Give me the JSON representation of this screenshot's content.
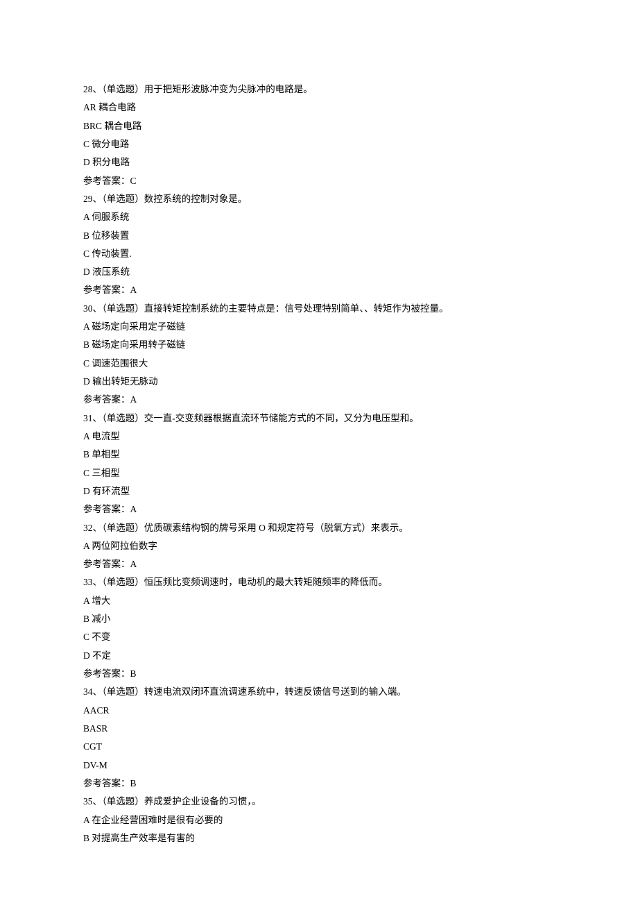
{
  "lines": [
    "28、（单选题）用于把矩形波脉冲变为尖脉冲的电路是。",
    "AR 耦合电路",
    "BRC 耦合电路",
    "C 微分电路",
    "D 积分电路",
    "参考答案：C",
    "29、（单选题）数控系统的控制对象是。",
    "A 伺服系统",
    "B 位移装置",
    "C 传动装置.",
    "D 液压系统",
    "参考答案：A",
    "30、（单选题）直接转矩控制系统的主要特点是：信号处理特别简单、、转矩作为被控量。",
    "A 磁场定向采用定子磁链",
    "B 磁场定向采用转子磁链",
    "C 调速范围很大",
    "D 输出转矩无脉动",
    "参考答案：A",
    "31、（单选题）交一直-交变频器根据直流环节储能方式的不同，又分为电压型和。",
    "A 电流型",
    "B 单相型",
    "C 三相型",
    "D 有环流型",
    "参考答案：A",
    "32、（单选题）优质碳素结构钢的牌号采用 O 和规定符号（脱氧方式）来表示。",
    "A 两位阿拉伯数字",
    "参考答案：A",
    "33、（单选题）恒压频比变频调速时，电动机的最大转矩随频率的降低而。",
    "A 增大",
    "B 减小",
    "C 不变",
    "D 不定",
    "参考答案：B",
    "34、（单选题）转速电流双闭环直流调速系统中，转速反馈信号送到的输入端。",
    "AACR",
    "BASR",
    "CGT",
    "DV-M",
    "参考答案：B",
    "35、（单选题）养成爱护企业设备的习惯，。",
    "A 在企业经营困难时是很有必要的",
    "B 对提高生产效率是有害的"
  ]
}
